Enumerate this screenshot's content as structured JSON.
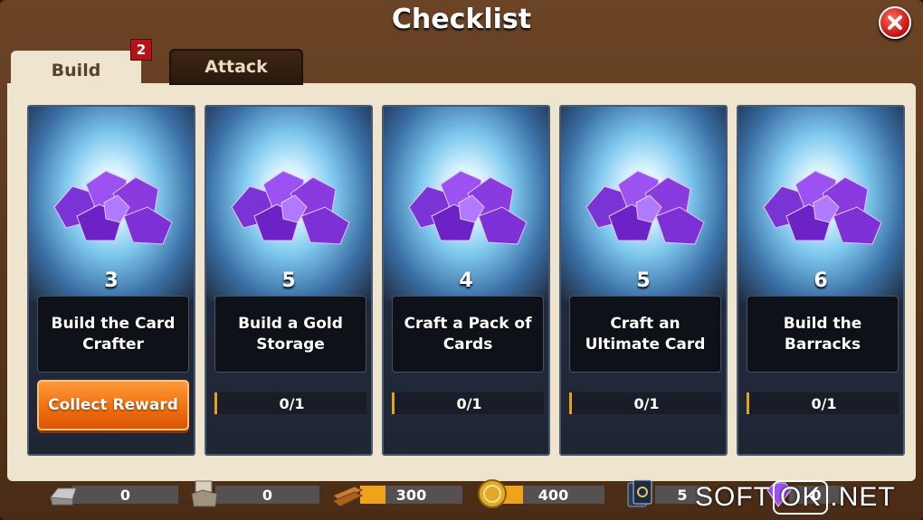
{
  "window": {
    "title": "Checklist"
  },
  "tabs": [
    {
      "label": "Build",
      "badge": "2"
    },
    {
      "label": "Attack"
    }
  ],
  "cards": [
    {
      "reward": "3",
      "task": "Build the Card Crafter",
      "action": "Collect Reward"
    },
    {
      "reward": "5",
      "task": "Build a Gold Storage",
      "progress": "0/1"
    },
    {
      "reward": "4",
      "task": "Craft a Pack of Cards",
      "progress": "0/1"
    },
    {
      "reward": "5",
      "task": "Craft an Ultimate Card",
      "progress": "0/1"
    },
    {
      "reward": "6",
      "task": "Build the Barracks",
      "progress": "0/1"
    }
  ],
  "resources": [
    {
      "icon": "iron-ingot-icon",
      "value": "0",
      "fill": 0
    },
    {
      "icon": "stone-icon",
      "value": "0",
      "fill": 0
    },
    {
      "icon": "wood-planks-icon",
      "value": "300",
      "fill": 0.25
    },
    {
      "icon": "gold-coin-icon",
      "value": "400",
      "fill": 0.2
    },
    {
      "icon": "card-deck-icon",
      "value": "5"
    },
    {
      "icon": "gem-icon",
      "value": "0"
    }
  ],
  "watermark": {
    "left": "SOFT",
    "middle": "OK",
    "right": ".NET"
  },
  "colors": {
    "accent_orange": "#f0700e",
    "badge_red": "#b41414",
    "gem_purple": "#8a3be0"
  }
}
